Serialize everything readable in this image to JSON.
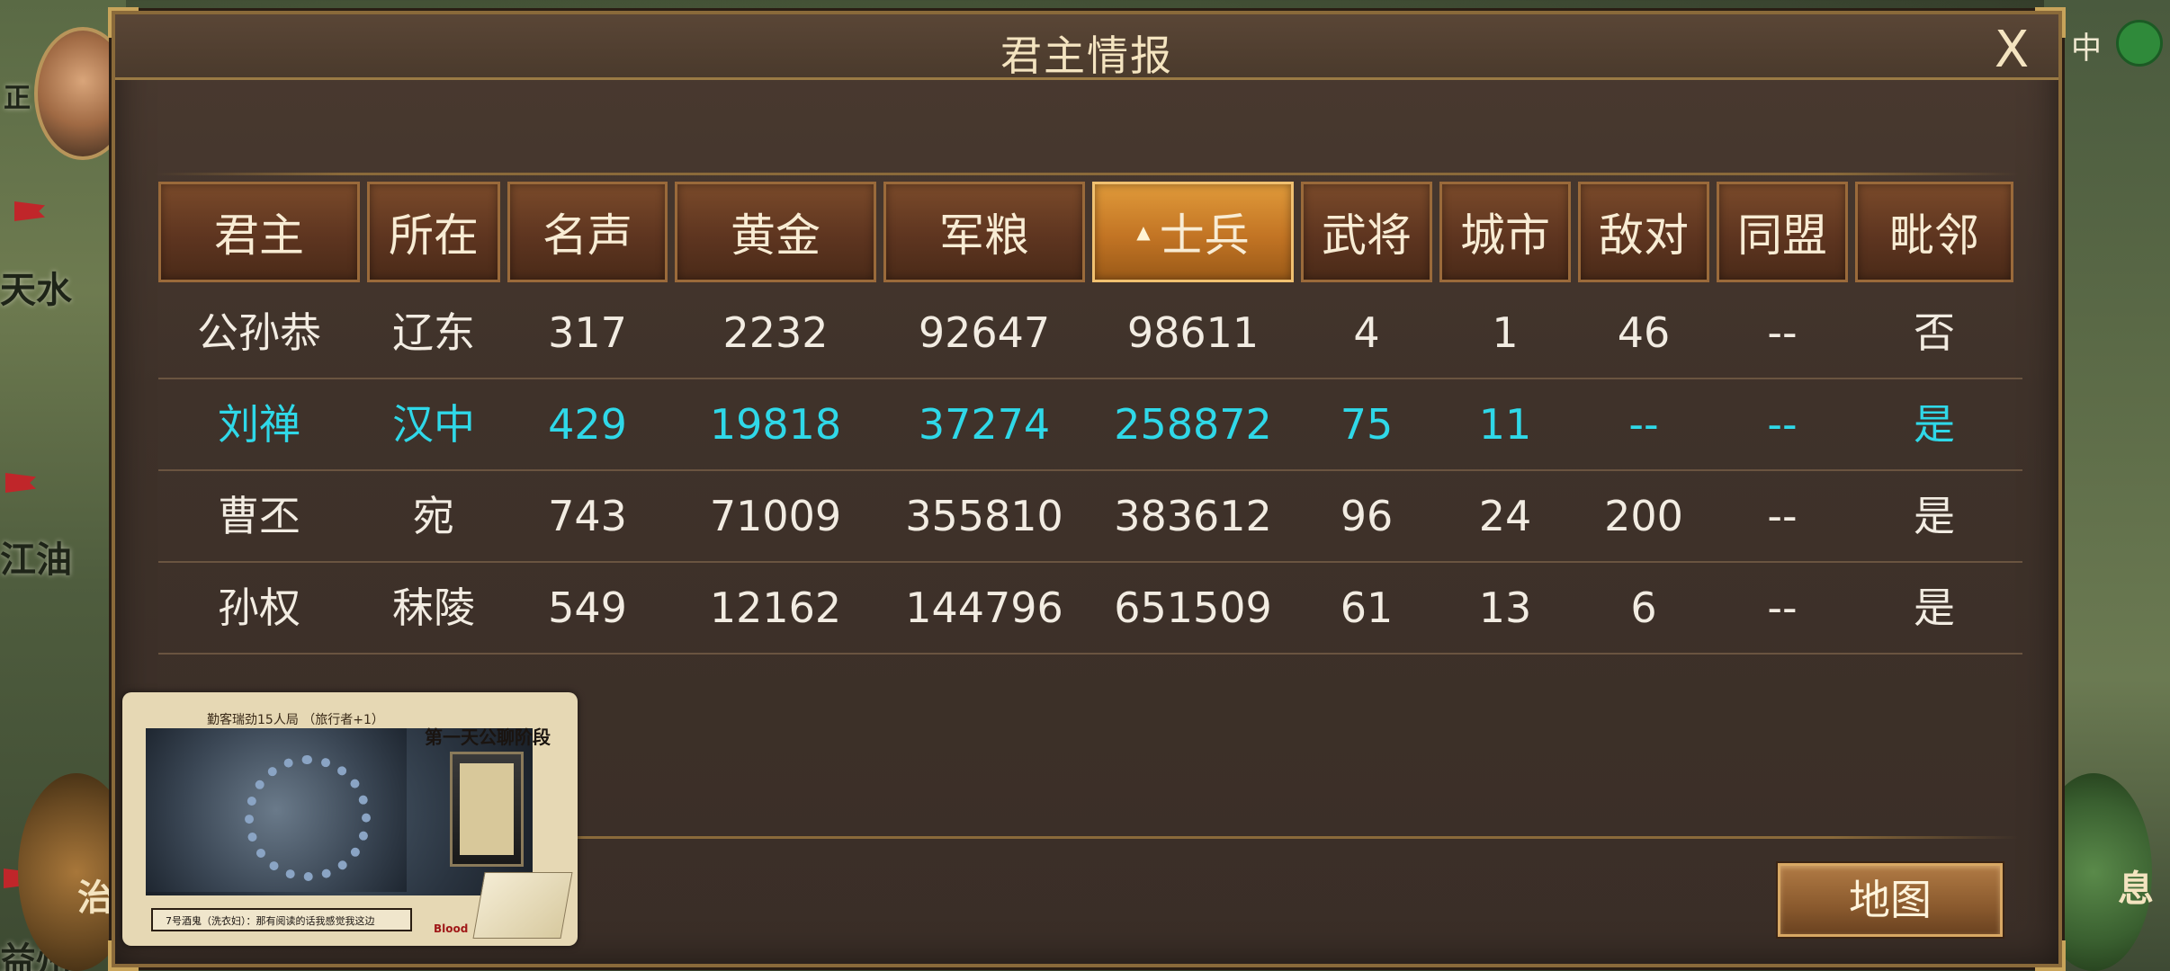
{
  "map": {
    "labels": {
      "zheng": "正",
      "tianshui": "天水",
      "jiangyou": "江油",
      "zhou": "益州",
      "zhi": "治",
      "zhong": "中",
      "xi": "息"
    }
  },
  "dialog": {
    "title": "君主情报",
    "close_label": "X"
  },
  "table": {
    "columns": [
      "君主",
      "所在",
      "名声",
      "黄金",
      "军粮",
      "士兵",
      "武将",
      "城市",
      "敌对",
      "同盟",
      "毗邻"
    ],
    "sorted_column_index": 5,
    "rows": [
      {
        "lord": "公孙恭",
        "location": "辽东",
        "fame": "317",
        "gold": "2232",
        "food": "92647",
        "soldiers": "98611",
        "generals": "4",
        "cities": "1",
        "hostile": "46",
        "allied": "--",
        "adjacent": "否",
        "is_self": false
      },
      {
        "lord": "刘禅",
        "location": "汉中",
        "fame": "429",
        "gold": "19818",
        "food": "37274",
        "soldiers": "258872",
        "generals": "75",
        "cities": "11",
        "hostile": "--",
        "allied": "--",
        "adjacent": "是",
        "is_self": true
      },
      {
        "lord": "曹丕",
        "location": "宛",
        "fame": "743",
        "gold": "71009",
        "food": "355810",
        "soldiers": "383612",
        "generals": "96",
        "cities": "24",
        "hostile": "200",
        "allied": "--",
        "adjacent": "是",
        "is_self": false
      },
      {
        "lord": "孙权",
        "location": "秣陵",
        "fame": "549",
        "gold": "12162",
        "food": "144796",
        "soldiers": "651509",
        "generals": "61",
        "cities": "13",
        "hostile": "6",
        "allied": "--",
        "adjacent": "是",
        "is_self": false
      }
    ]
  },
  "actions": {
    "map_button": "地图"
  },
  "overlay": {
    "title": "勤客瑞劲15人局 （旅行者+1）",
    "subtitle": "第一天公聊阶段",
    "caption": "7号酒鬼（洗衣妇）：那有阅读的话我感觉我这边",
    "brand": "Blood"
  },
  "colors": {
    "self_row_text": "#2fd8e8",
    "header_bg": "#5e3520",
    "header_active_bg": "#c27424",
    "panel_bg": "#3f322a"
  }
}
